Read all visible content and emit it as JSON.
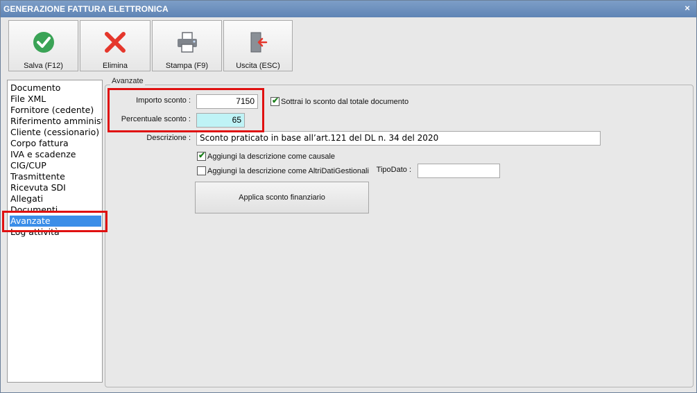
{
  "window": {
    "title": "GENERAZIONE FATTURA ELETTRONICA",
    "close_glyph": "×"
  },
  "toolbar": {
    "save_label": "Salva (F12)",
    "delete_label": "Elimina",
    "print_label": "Stampa (F9)",
    "exit_label": "Uscita (ESC)"
  },
  "nav": {
    "items": [
      {
        "label": "Documento"
      },
      {
        "label": "File XML"
      },
      {
        "label": "Fornitore (cedente)"
      },
      {
        "label": "Riferimento amministrativo"
      },
      {
        "label": "Cliente (cessionario)"
      },
      {
        "label": "Corpo fattura"
      },
      {
        "label": "IVA e scadenze"
      },
      {
        "label": "CIG/CUP"
      },
      {
        "label": "Trasmittente"
      },
      {
        "label": "Ricevuta SDI"
      },
      {
        "label": "Allegati"
      },
      {
        "label": "Documenti"
      },
      {
        "label": "Avanzate"
      },
      {
        "label": "Log attività"
      }
    ],
    "selected": "Avanzate"
  },
  "advanced": {
    "group_title": "Avanzate",
    "discount_amount_label": "Importo sconto :",
    "discount_amount_value": "7150",
    "discount_percent_label": "Percentuale sconto :",
    "discount_percent_value": "65",
    "subtract_checkbox_label": "Sottrai lo sconto dal totale documento",
    "subtract_checked": true,
    "description_label": "Descrizione :",
    "description_value": "Sconto praticato in base all’art.121 del DL n. 34 del 2020",
    "add_causale_label": "Aggiungi la descrizione come causale",
    "add_causale_checked": true,
    "add_altri_label": "Aggiungi la descrizione come AltriDatiGestionali",
    "add_altri_checked": false,
    "tipo_dato_label": "TipoDato :",
    "tipo_dato_value": "",
    "apply_button_label": "Applica sconto finanziario"
  },
  "colors": {
    "titlebar": "#6a8fbe",
    "selection": "#3b8ee8",
    "focused_field": "#bff3f6",
    "annotation_red": "#e01010",
    "save_icon": "#3aa356",
    "delete_icon": "#e5372c"
  }
}
